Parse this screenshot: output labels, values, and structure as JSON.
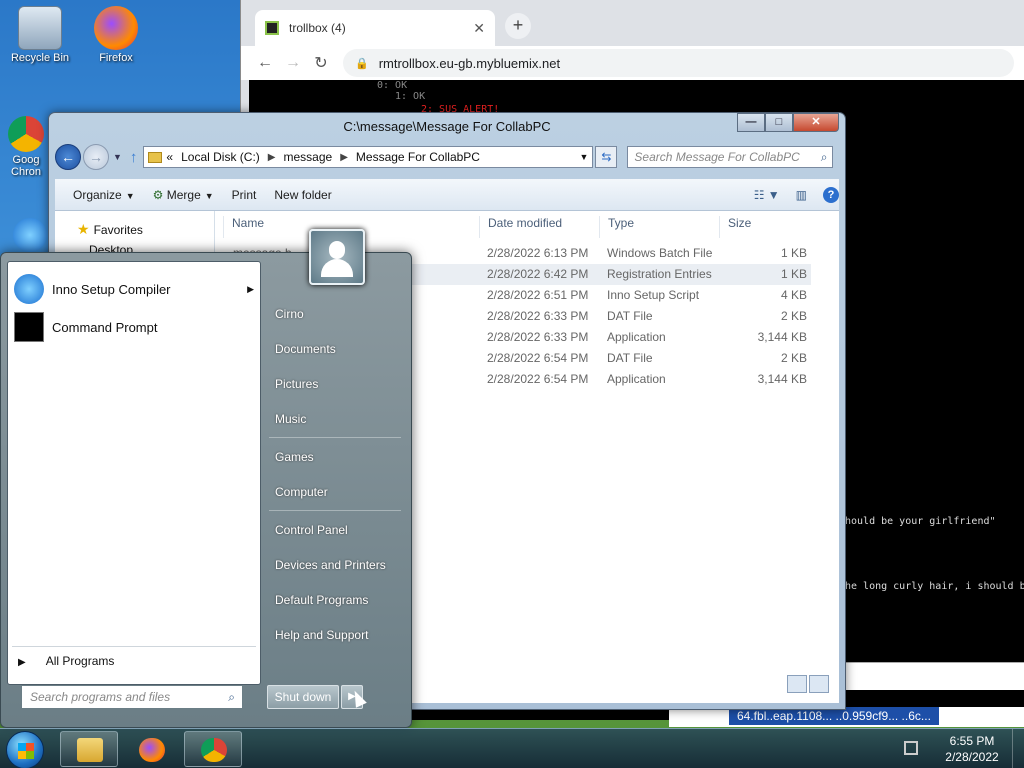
{
  "desktop": {
    "icons": [
      {
        "label": "Recycle Bin"
      },
      {
        "label": "Firefox"
      },
      {
        "label": "Goog Chron"
      }
    ]
  },
  "browser": {
    "tab_title": "trollbox (4)",
    "tab_close": "✕",
    "new_tab": "+",
    "url": "rmtrollbox.eu-gb.mybluemix.net",
    "content_lines": [
      "0: OK",
      "1: OK",
      "2: SUS ALERT!",
      "hould be your girlfriend\"",
      "he long curly hair, i should b"
    ],
    "bottom_text": "64.fbl..eap.1108... ..0.959cf9...  ..6c..."
  },
  "explorer": {
    "title": "C:\\message\\Message For CollabPC",
    "caption_min": "—",
    "caption_max": "□",
    "caption_close": "✕",
    "breadcrumb_lead": "«",
    "breadcrumbs": [
      "Local Disk (C:)",
      "message",
      "Message For CollabPC"
    ],
    "search_placeholder": "Search Message For CollabPC",
    "commands": {
      "organize": "Organize",
      "merge": "Merge",
      "print": "Print",
      "new_folder": "New folder"
    },
    "nav": {
      "favorites": "Favorites",
      "desktop": "Desktop"
    },
    "columns": {
      "name": "Name",
      "date_modified": "Date modified",
      "type": "Type",
      "size": "Size"
    },
    "files": [
      {
        "name": "message b",
        "date": "2/28/2022 6:13 PM",
        "type": "Windows Batch File",
        "size": "1 KB"
      },
      {
        "name": "",
        "date": "2/28/2022 6:42 PM",
        "type": "Registration Entries",
        "size": "1 KB"
      },
      {
        "name": "",
        "date": "2/28/2022 6:51 PM",
        "type": "Inno Setup Script",
        "size": "4 KB"
      },
      {
        "name": "",
        "date": "2/28/2022 6:33 PM",
        "type": "DAT File",
        "size": "2 KB"
      },
      {
        "name": "",
        "date": "2/28/2022 6:33 PM",
        "type": "Application",
        "size": "3,144 KB"
      },
      {
        "name": "",
        "date": "2/28/2022 6:54 PM",
        "type": "DAT File",
        "size": "2 KB"
      },
      {
        "name": "",
        "date": "2/28/2022 6:54 PM",
        "type": "Application",
        "size": "3,144 KB"
      }
    ]
  },
  "start_menu": {
    "programs": [
      {
        "label": "Inno Setup Compiler",
        "has_submenu": true
      },
      {
        "label": "Command Prompt",
        "has_submenu": false
      }
    ],
    "all_programs": "All Programs",
    "search_placeholder": "Search programs and files",
    "right_links": [
      "Cirno",
      "Documents",
      "Pictures",
      "Music",
      "Games",
      "Computer",
      "Control Panel",
      "Devices and Printers",
      "Default Programs",
      "Help and Support"
    ],
    "shutdown_label": "Shut down"
  },
  "taskbar": {
    "time": "6:55 PM",
    "date": "2/28/2022"
  },
  "colors": {
    "accent": "#2c6fce",
    "selected_row": "#eaeef3",
    "alert_red": "#e22222"
  }
}
